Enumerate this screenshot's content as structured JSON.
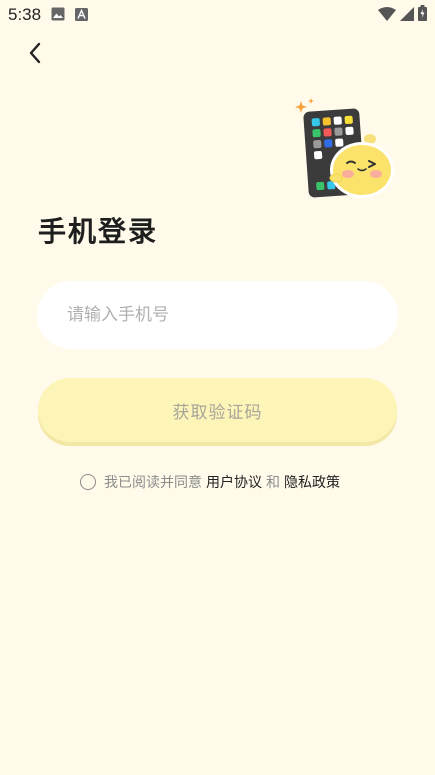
{
  "status_bar": {
    "time": "5:38",
    "icons": [
      "image-notification-icon",
      "app-notification-icon",
      "wifi-icon",
      "signal-icon",
      "battery-icon"
    ]
  },
  "nav": {
    "back_icon": "chevron-left-icon"
  },
  "title": "手机登录",
  "phone": {
    "placeholder": "请输入手机号",
    "value": ""
  },
  "get_code_label": "获取验证码",
  "agreement": {
    "prefix": "我已阅读并同意",
    "user_agreement": "用户协议",
    "conjunction": "和",
    "privacy_policy": "隐私政策",
    "checked": false
  },
  "colors": {
    "background": "#fffaea",
    "button": "#fdf4b8",
    "input": "#ffffff",
    "muted_text": "#8c8c8c"
  }
}
